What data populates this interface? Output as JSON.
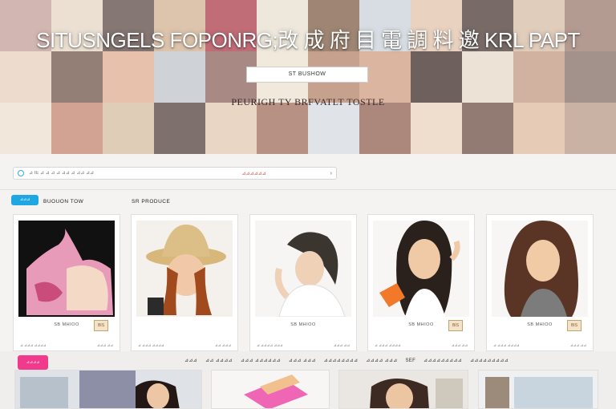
{
  "hero": {
    "title": "SITUSNGELS FOPONRG;改 成 府 目 電 調 料 邀 KRL PAPT",
    "button_label": "ST BUSHOW",
    "tagline": "PEURIGH   TY BRFVATLT TOSTLE"
  },
  "search": {
    "placeholder": "⊿ IE ⊿ ⊿ ⊿ ⊿ ⊿⊿ ⊿ ⊿⊿ ⊿⊿",
    "center_text": "⊿⊿⊿⊿⊿⊿",
    "chevron": "›"
  },
  "sections": {
    "pill_label": "⊿⊿⊿",
    "label_1": "BUOUON TOW",
    "label_2": "SR PRODUCE"
  },
  "cards": [
    {
      "name": "SB MHIOO",
      "tag": "BIS",
      "foot_left": "⊿ ⊿⊿⊿ ⊿⊿⊿⊿",
      "foot_right": "⊿⊿⊿ ⊿⊿"
    },
    {
      "name": "",
      "tag": "⊿⊿",
      "foot_left": "⊿ ⊿⊿⊿ ⊿⊿⊿⊿",
      "foot_right": "⊿⊿ ⊿⊿⊿"
    },
    {
      "name": "SB MHIOO",
      "tag": "",
      "foot_left": "⊿ ⊿⊿⊿⊿ ⊿⊿⊿",
      "foot_right": "⊿⊿⊿ ⊿⊿"
    },
    {
      "name": "SB MHIOO",
      "tag": "BIS",
      "foot_left": "⊿ ⊿⊿⊿ ⊿⊿⊿⊿",
      "foot_right": "⊿⊿⊿ ⊿⊿"
    },
    {
      "name": "SB MHIOO",
      "tag": "BIS",
      "foot_left": "⊿ ⊿⊿⊿ ⊿⊿⊿⊿",
      "foot_right": "⊿⊿⊿ ⊿⊿"
    }
  ],
  "strip": {
    "pill_label": "⊿⊿⊿⊿",
    "filters": [
      "⊿⊿⊿",
      "⊿⊿ ⊿⊿⊿⊿",
      "⊿⊿⊿ ⊿⊿⊿⊿⊿⊿",
      "⊿⊿⊿ ⊿⊿⊿",
      "⊿⊿⊿⊿⊿⊿⊿⊿",
      "⊿⊿⊿⊿ ⊿⊿⊿",
      "SEF",
      "⊿⊿⊿⊿⊿⊿⊿⊿⊿",
      "⊿⊿⊿⊿⊿⊿⊿⊿⊿"
    ]
  },
  "colors": {
    "accent_blue": "#1fa7e3",
    "accent_pink": "#f13a8b",
    "search_link": "#2a79b9",
    "tag_bg": "#f3e3c8"
  }
}
